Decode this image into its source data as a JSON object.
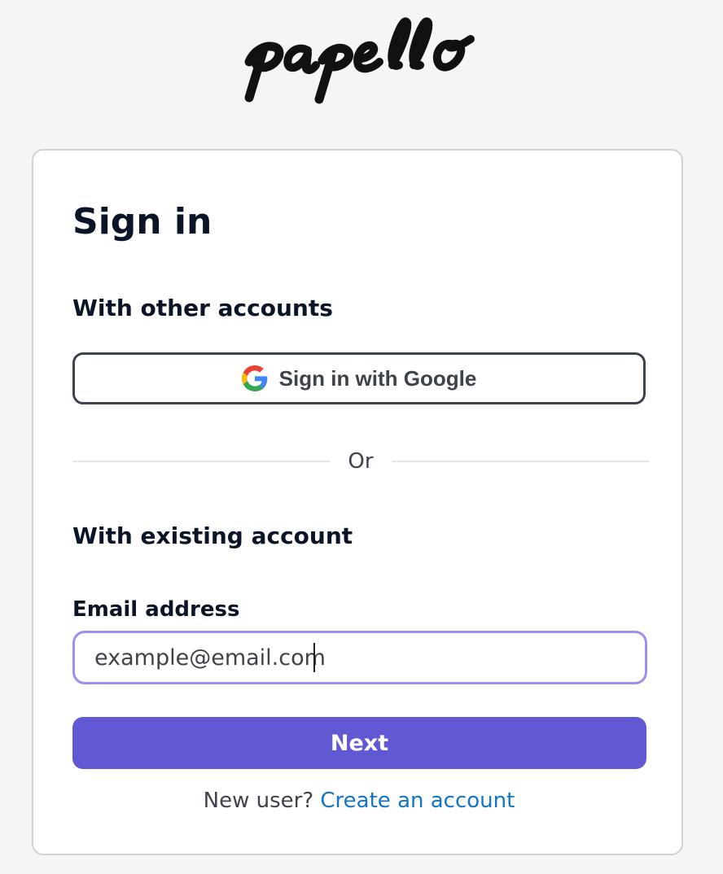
{
  "brand": {
    "logo_text": "papello"
  },
  "signin": {
    "title": "Sign in",
    "other_accounts_heading": "With other accounts",
    "google_button_label": "Sign in with Google",
    "divider_text": "Or",
    "existing_account_heading": "With existing account",
    "email_label": "Email address",
    "email_placeholder": "example@email.com",
    "email_value": "",
    "next_button_label": "Next",
    "new_user_text": "New user?",
    "create_account_link": "Create an account"
  },
  "colors": {
    "page_background": "#f5f5f5",
    "primary_button": "#6358d4",
    "input_focus_border": "#9d8ef0",
    "link": "#1275c6",
    "heading_text": "#0b1527",
    "body_text": "#3d424b"
  },
  "icons": {
    "google": "google-g-icon"
  }
}
